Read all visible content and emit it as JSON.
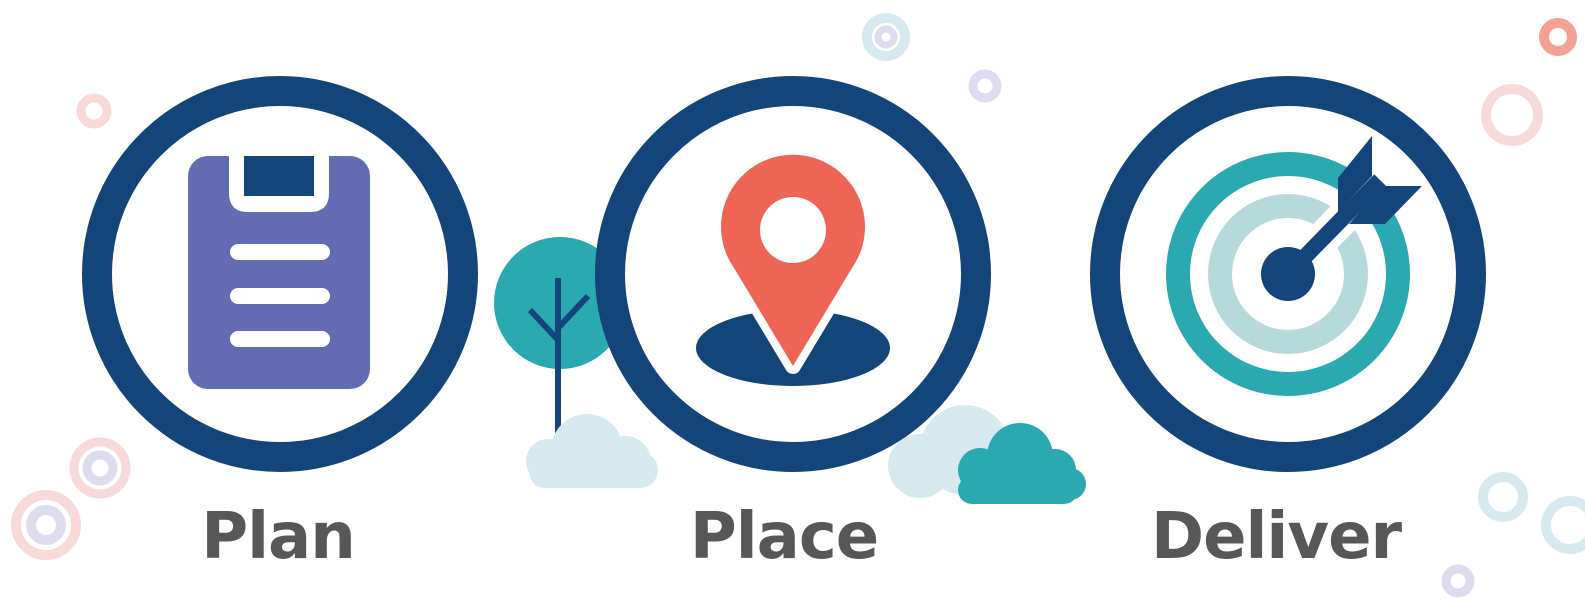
{
  "steps": [
    {
      "label": "Plan",
      "icon": "clipboard-icon"
    },
    {
      "label": "Place",
      "icon": "map-pin-icon"
    },
    {
      "label": "Deliver",
      "icon": "target-arrow-icon"
    }
  ],
  "colors": {
    "navy": "#13457a",
    "purple": "#636bb2",
    "coral": "#ef6555",
    "teal": "#2aa9b1",
    "light_teal": "#b6dadb",
    "cloud": "#d6e9ee",
    "pink_ring": "#f7d6d6",
    "lavender": "#dcdcee",
    "text": "#575757"
  }
}
